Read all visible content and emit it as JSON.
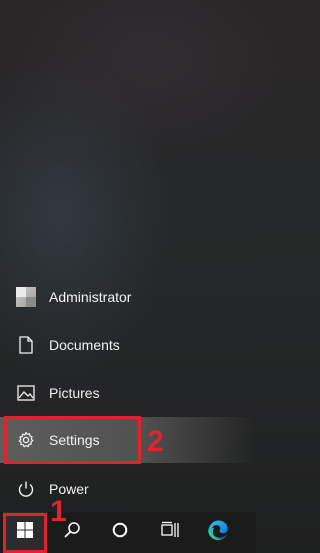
{
  "start_menu": {
    "items": [
      {
        "label": "Administrator",
        "icon": "user-avatar-icon"
      },
      {
        "label": "Documents",
        "icon": "document-icon"
      },
      {
        "label": "Pictures",
        "icon": "picture-icon"
      },
      {
        "label": "Settings",
        "icon": "gear-icon"
      },
      {
        "label": "Power",
        "icon": "power-icon"
      }
    ]
  },
  "annotations": {
    "step1": "1",
    "step2": "2",
    "color": "#e0242e"
  },
  "taskbar": {
    "buttons": [
      "windows-start-icon",
      "search-icon",
      "cortana-icon",
      "task-view-icon",
      "edge-icon"
    ]
  }
}
